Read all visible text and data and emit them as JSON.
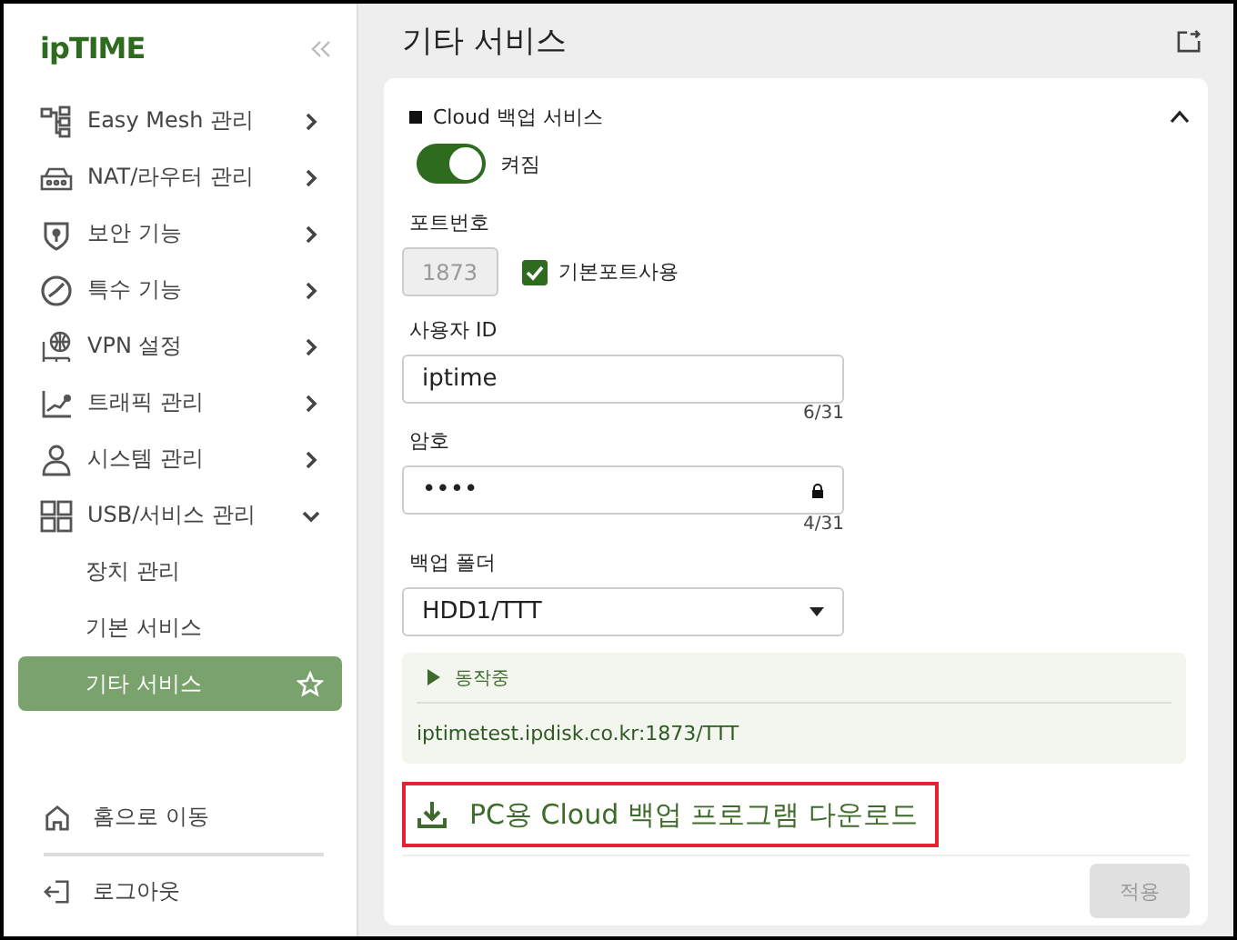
{
  "sidebar": {
    "logo": "ipTIME",
    "items": [
      {
        "label": "Easy Mesh 관리",
        "expanded": false
      },
      {
        "label": "NAT/라우터 관리",
        "expanded": false
      },
      {
        "label": "보안 기능",
        "expanded": false
      },
      {
        "label": "특수 기능",
        "expanded": false
      },
      {
        "label": "VPN 설정",
        "expanded": false
      },
      {
        "label": "트래픽 관리",
        "expanded": false
      },
      {
        "label": "시스템 관리",
        "expanded": false
      },
      {
        "label": "USB/서비스 관리",
        "expanded": true,
        "children": [
          {
            "label": "장치 관리",
            "selected": false
          },
          {
            "label": "기본 서비스",
            "selected": false
          },
          {
            "label": "기타 서비스",
            "selected": true
          }
        ]
      }
    ],
    "footer": [
      {
        "label": "홈으로 이동"
      },
      {
        "label": "로그아웃"
      }
    ]
  },
  "main": {
    "title": "기타 서비스",
    "card": {
      "section_title": "Cloud 백업 서비스",
      "expanded": true,
      "toggle": {
        "on": true,
        "label": "켜짐"
      },
      "port": {
        "label": "포트번호",
        "value": "1873",
        "disabled": true,
        "checkbox": {
          "label": "기본포트사용",
          "checked": true
        }
      },
      "user_id": {
        "label": "사용자 ID",
        "value": "iptime",
        "counter": "6/31"
      },
      "password": {
        "label": "암호",
        "value": "••••",
        "counter": "4/31"
      },
      "folder": {
        "label": "백업 폴더",
        "value": "HDD1/TTT"
      },
      "status": {
        "label": "동작중",
        "url": "iptimetest.ipdisk.co.kr:1873/TTT"
      },
      "download_link": {
        "label": "PC용 Cloud 백업 프로그램 다운로드",
        "highlighted": true
      },
      "apply_button": {
        "label": "적용",
        "disabled": true
      }
    }
  }
}
